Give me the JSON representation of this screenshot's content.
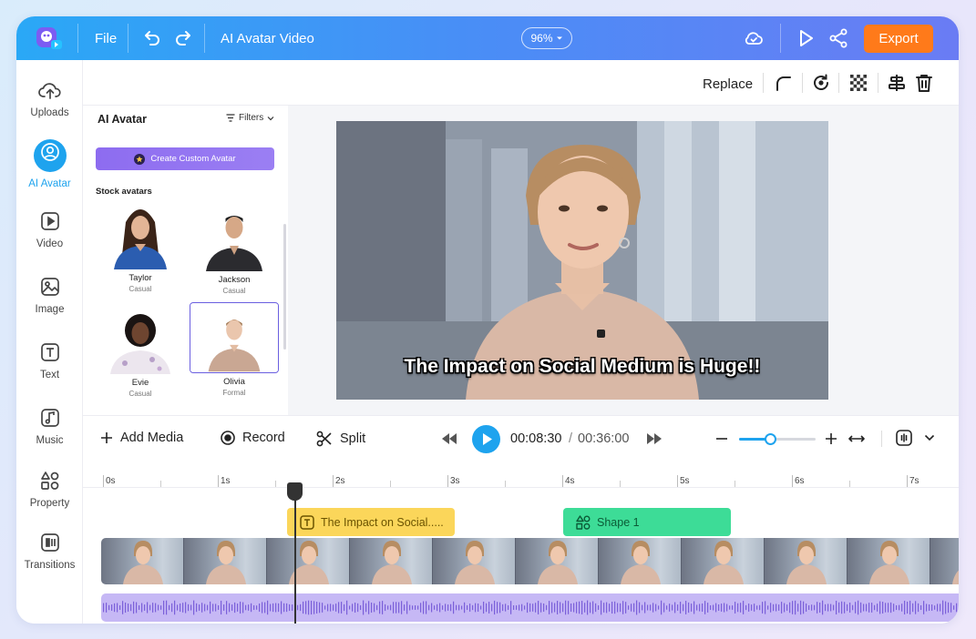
{
  "topbar": {
    "file_label": "File",
    "project_title": "AI Avatar Video",
    "zoom": "96%",
    "export_label": "Export"
  },
  "rail": {
    "items": [
      {
        "label": "Uploads",
        "icon": "cloud-upload-icon"
      },
      {
        "label": "AI Avatar",
        "icon": "avatar-icon",
        "active": true
      },
      {
        "label": "Video",
        "icon": "video-icon"
      },
      {
        "label": "Image",
        "icon": "image-icon"
      },
      {
        "label": "Text",
        "icon": "text-icon"
      },
      {
        "label": "Music",
        "icon": "music-icon"
      },
      {
        "label": "Property",
        "icon": "property-icon"
      },
      {
        "label": "Transitions",
        "icon": "transitions-icon"
      }
    ]
  },
  "toolbar": {
    "replace_label": "Replace"
  },
  "panel": {
    "title": "AI Avatar",
    "filters_label": "Filters",
    "create_label": "Create Custom Avatar",
    "stock_label": "Stock avatars",
    "avatars": [
      {
        "name": "Taylor",
        "style": "Casual"
      },
      {
        "name": "Jackson",
        "style": "Casual"
      },
      {
        "name": "Evie",
        "style": "Casual"
      },
      {
        "name": "Olivia",
        "style": "Formal",
        "selected": true
      }
    ]
  },
  "canvas": {
    "subtitle": "The Impact on Social Medium is Huge!!"
  },
  "playbar": {
    "add_media": "Add Media",
    "record": "Record",
    "split": "Split",
    "current_time": "00:08:30",
    "separator": "/",
    "total_time": "00:36:00",
    "zoom_level": 0.4
  },
  "timeline": {
    "ticks": [
      "0s",
      "1s",
      "2s",
      "3s",
      "4s",
      "5s",
      "6s",
      "7s"
    ],
    "text_clip": "The Impact on Social.....",
    "shape_clip": "Shape 1"
  },
  "colors": {
    "accent": "#1ea3ee",
    "export": "#ff7a1a",
    "text_clip": "#fbd65a",
    "shape_clip": "#3ddc97",
    "audio": "#c6b8f5",
    "create_button": "#8d6cf0"
  }
}
